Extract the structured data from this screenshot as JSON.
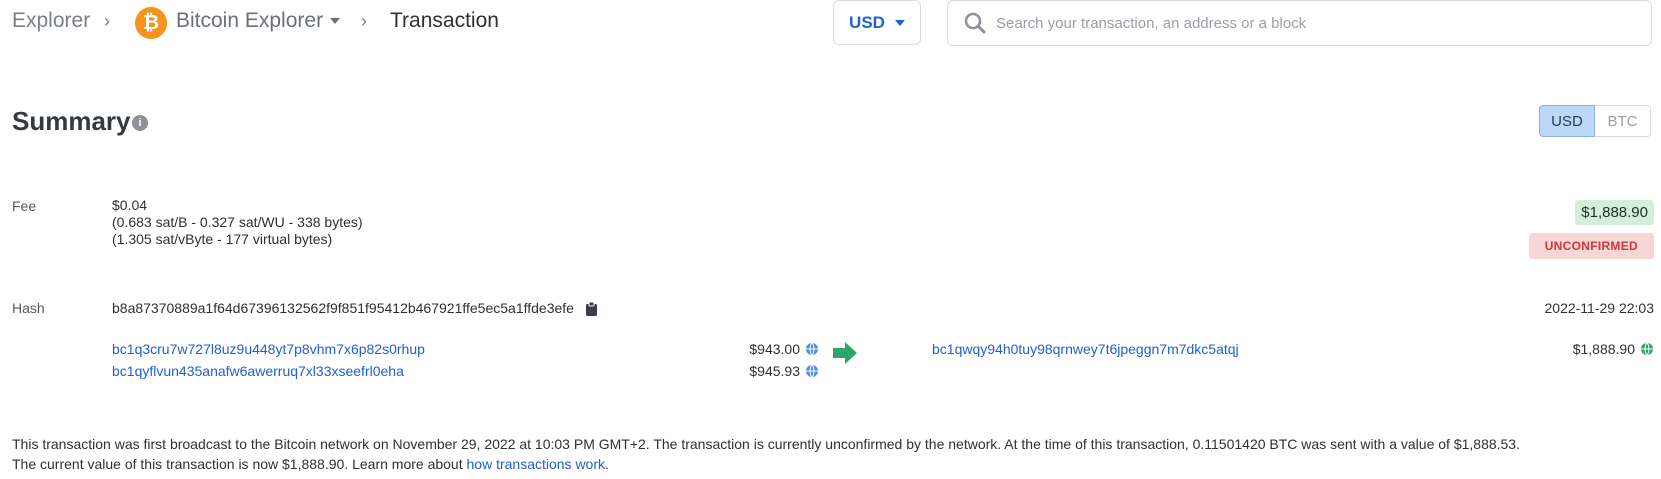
{
  "breadcrumb": {
    "root": "Explorer",
    "network": "Bitcoin Explorer",
    "current": "Transaction",
    "separator": "›",
    "network_icon_letter": "₿"
  },
  "currency_select": {
    "value": "USD"
  },
  "search": {
    "placeholder": "Search your transaction, an address or a block"
  },
  "summary": {
    "title": "Summary",
    "info_icon": "i",
    "toggle": {
      "usd": "USD",
      "btc": "BTC",
      "active": "USD"
    }
  },
  "fee": {
    "label": "Fee",
    "value": "$0.04",
    "detail1": "(0.683 sat/B - 0.327 sat/WU - 338 bytes)",
    "detail2": "(1.305 sat/vByte - 177 virtual bytes)"
  },
  "total_badge": "$1,888.90",
  "status_badge": "UNCONFIRMED",
  "hash": {
    "label": "Hash",
    "value": "b8a87370889a1f64d67396132562f9f851f95412b467921ffe5ec5a1ffde3efe"
  },
  "timestamp": "2022-11-29 22:03",
  "inputs": [
    {
      "address": "bc1q3cru7w727l8uz9u448yt7p8vhm7x6p82s0rhup",
      "amount": "$943.00"
    },
    {
      "address": "bc1qyflvun435anafw6awerruq7xl33xseefrl0eha",
      "amount": "$945.93"
    }
  ],
  "outputs": [
    {
      "address": "bc1qwqy94h0tuy98qrnwey7t6jpeggn7m7dkc5atqj",
      "amount": "$1,888.90"
    }
  ],
  "description": {
    "text1": "This transaction was first broadcast to the Bitcoin network on November 29, 2022 at 10:03 PM GMT+2.  The transaction is currently unconfirmed by the network.  At the time of this transaction, 0.11501420 BTC was sent with a value of $1,888.53.",
    "text2": "The current value of this transaction is now $1,888.90.  Learn more about ",
    "link": "how transactions work",
    "end": "."
  },
  "colors": {
    "bitcoin_orange": "#f7931a",
    "link_blue": "#1f5fd0",
    "arrow_green": "#2ea66a",
    "unconfirmed_red": "#d0373a"
  },
  "icons": [
    "chevron-right-icon",
    "bitcoin-icon",
    "caret-down-icon",
    "search-icon",
    "info-icon",
    "clipboard-icon",
    "globe-icon",
    "arrow-right-icon"
  ]
}
